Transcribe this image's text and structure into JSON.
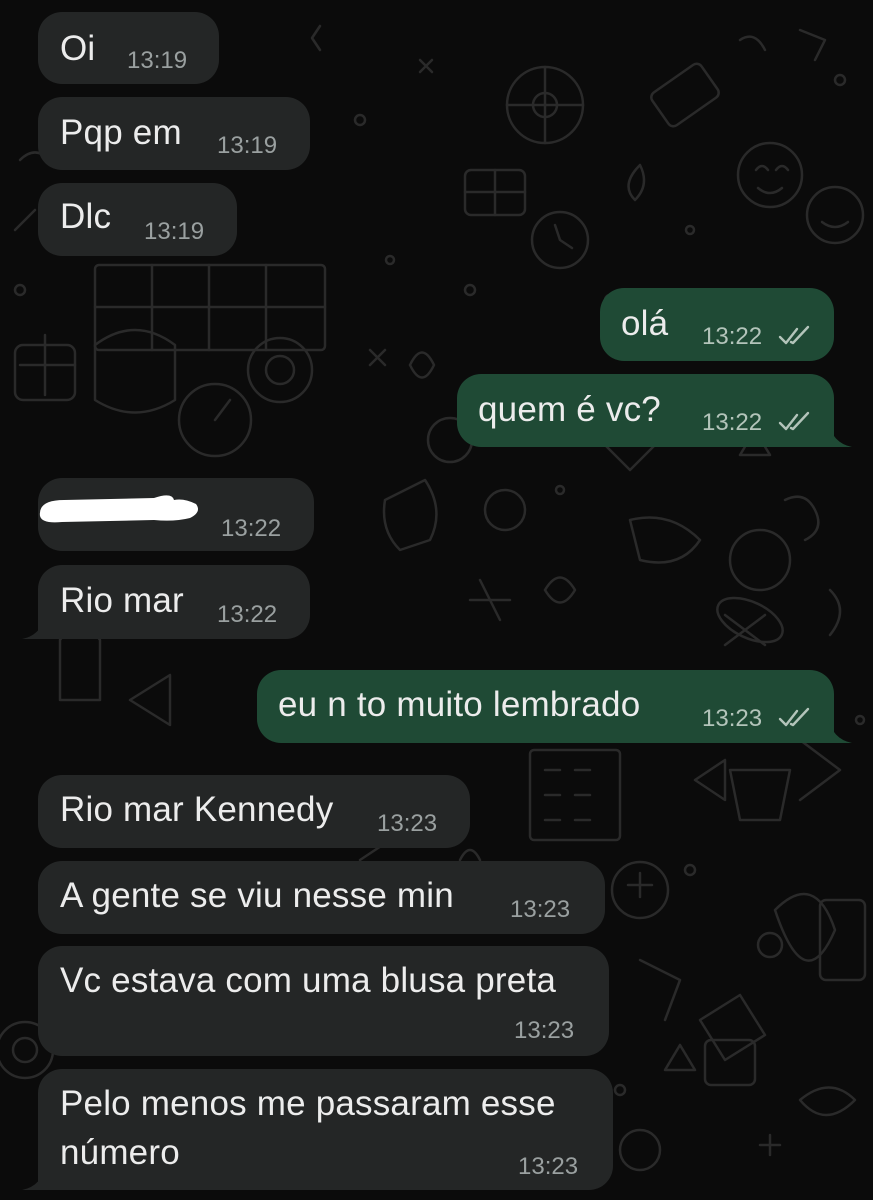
{
  "colors": {
    "background": "#0b0b0b",
    "incoming_bubble": "#242626",
    "outgoing_bubble": "#1f4a35",
    "text": "#ececec",
    "timestamp": "#9aa0a0"
  },
  "messages": [
    {
      "dir": "in",
      "text": "Oi",
      "time": "13:19"
    },
    {
      "dir": "in",
      "text": "Pqp em",
      "time": "13:19"
    },
    {
      "dir": "in",
      "text": "Dlc",
      "time": "13:19"
    },
    {
      "dir": "out",
      "text": "olá",
      "time": "13:22",
      "status_icon": "read-double-check-icon"
    },
    {
      "dir": "out",
      "text": "quem é vc?",
      "time": "13:22",
      "status_icon": "read-double-check-icon"
    },
    {
      "dir": "in",
      "text": "",
      "time": "13:22",
      "redacted": true
    },
    {
      "dir": "in",
      "text": "Rio mar",
      "time": "13:22"
    },
    {
      "dir": "out",
      "text": "eu n to muito lembrado",
      "time": "13:23",
      "status_icon": "read-double-check-icon"
    },
    {
      "dir": "in",
      "text": "Rio mar Kennedy",
      "time": "13:23"
    },
    {
      "dir": "in",
      "text": "A gente se viu nesse min",
      "time": "13:23"
    },
    {
      "dir": "in",
      "text": "Vc estava com uma blusa preta",
      "time": "13:23"
    },
    {
      "dir": "in",
      "text_lines": [
        "Pelo menos me passaram esse",
        "número"
      ],
      "time": "13:23"
    }
  ]
}
